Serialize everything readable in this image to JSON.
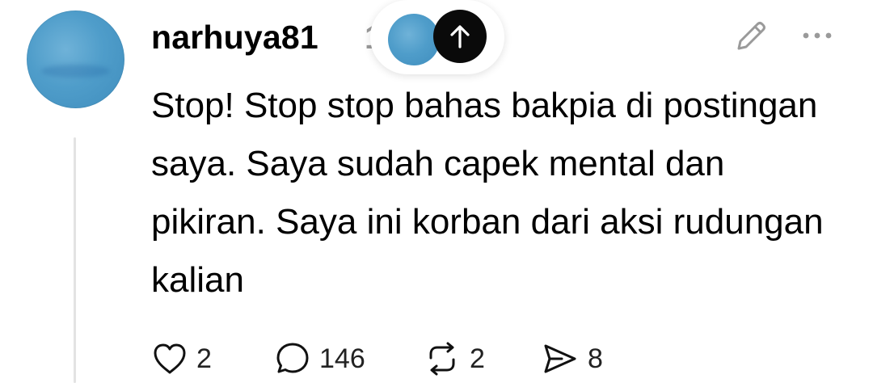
{
  "post": {
    "username": "narhuya81",
    "username_trail": "1",
    "body": "Stop! Stop stop bahas bakpia di postingan saya. Saya sudah capek mental dan pikiran. Saya ini korban dari aksi rudungan kalian"
  },
  "icons": {
    "edit": "pencil-icon",
    "more": "more-horizontal-icon",
    "scroll_top": "arrow-up-icon",
    "like": "heart-icon",
    "comment": "comment-icon",
    "repost": "repost-icon",
    "share": "send-icon"
  },
  "actions": {
    "likes": "2",
    "comments": "146",
    "reposts": "2",
    "shares": "8"
  },
  "colors": {
    "avatar_blue": "#4f9dca",
    "icon_gray": "#9a9a9a",
    "arrow_button": "#0a0a0a"
  }
}
